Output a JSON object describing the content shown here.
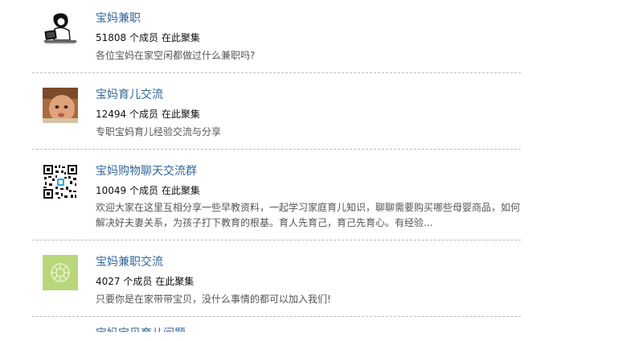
{
  "groups": [
    {
      "title": "宝妈兼职",
      "member_count": "51808",
      "member_suffix": "个成员 在此聚集",
      "description": "各位宝妈在家空闲都做过什么兼职吗?",
      "avatar": "cartoon-mom-computer"
    },
    {
      "title": "宝妈育儿交流",
      "member_count": "12494",
      "member_suffix": "个成员 在此聚集",
      "description": "专职宝妈育儿经验交流与分享",
      "avatar": "baby-photo"
    },
    {
      "title": "宝妈购物聊天交流群",
      "member_count": "10049",
      "member_suffix": "个成员 在此聚集",
      "description": "欢迎大家在这里互相分享一些早教资料，一起学习家庭育儿知识，聊聊需要购买哪些母婴商品，如何解决好夫妻关系，为孩子打下教育的根基。育人先育己，育己先育心。有经验...",
      "avatar": "qr-code"
    },
    {
      "title": "宝妈兼职交流",
      "member_count": "4027",
      "member_suffix": "个成员 在此聚集",
      "description": "只要你是在家带带宝贝，没什么事情的都可以加入我们!",
      "avatar": "green-flower-badge"
    },
    {
      "title": "宝妈宝贝育儿问题"
    }
  ],
  "colors": {
    "link": "#336699",
    "text": "#111111",
    "muted": "#555555",
    "divider": "#bdbdbd"
  }
}
